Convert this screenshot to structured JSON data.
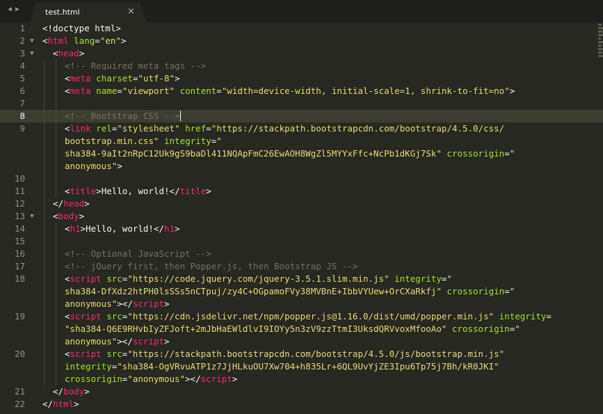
{
  "tab": {
    "title": "test.html",
    "close_glyph": "×"
  },
  "nav": {
    "back_icon": "◀",
    "forward_icon": "▶"
  },
  "fold_glyph": "▼",
  "colors": {
    "background": "#272822",
    "tag": "#f92672",
    "attribute": "#a6e22e",
    "string": "#e6db74",
    "comment": "#75715e",
    "text": "#f8f8f2"
  },
  "editor": {
    "current_line": "8",
    "line_numbers": [
      "1",
      "2",
      "3",
      "4",
      "5",
      "6",
      "7",
      "8",
      "9",
      "",
      "",
      "",
      "10",
      "11",
      "12",
      "13",
      "14",
      "15",
      "16",
      "17",
      "18",
      "",
      "",
      "19",
      "",
      "",
      "20",
      "",
      "",
      "21",
      "22"
    ],
    "code": {
      "l01": [
        "<!doctype html>"
      ],
      "l02": [
        "<",
        "html",
        " ",
        "lang",
        "=",
        "\"en\"",
        ">"
      ],
      "l03": [
        "  <",
        "head",
        ">"
      ],
      "l04": [
        "<!-- Required meta tags -->"
      ],
      "l05": [
        "<",
        "meta",
        " ",
        "charset",
        "=",
        "\"utf-8\"",
        ">"
      ],
      "l06": [
        "<",
        "meta",
        " ",
        "name",
        "=",
        "\"viewport\"",
        " ",
        "content",
        "=",
        "\"width=device-width, initial-scale=1, shrink-to-fit=no\"",
        ">"
      ],
      "l08": [
        "<!-- Bootstrap CSS -->"
      ],
      "l09a": [
        "<",
        "link",
        " ",
        "rel",
        "=",
        "\"stylesheet\"",
        " ",
        "href",
        "=",
        "\"https://stackpath.bootstrapcdn.com/bootstrap/4.5.0/css/"
      ],
      "l09b": [
        "bootstrap.min.css\"",
        " ",
        "integrity",
        "=",
        "\""
      ],
      "l09c": [
        "sha384-9aIt2nRpC12Uk9gS9baDl411NQApFmC26EwAOH8WgZl5MYYxFfc+NcPb1dKGj7Sk\"",
        " ",
        "crossorigin",
        "=",
        "\""
      ],
      "l09d": [
        "anonymous\"",
        ">"
      ],
      "l11": [
        "<",
        "title",
        ">",
        "Hello, world!",
        "</",
        "title",
        ">"
      ],
      "l12": [
        "</",
        "head",
        ">"
      ],
      "l13": [
        "<",
        "body",
        ">"
      ],
      "l14": [
        "<",
        "h1",
        ">",
        "Hello, world!",
        "</",
        "h1",
        ">"
      ],
      "l16": [
        "<!-- Optional JavaScript -->"
      ],
      "l17": [
        "<!-- jQuery first, then Popper.js, then Bootstrap JS -->"
      ],
      "l18a": [
        "<",
        "script",
        " ",
        "src",
        "=",
        "\"https://code.jquery.com/jquery-3.5.1.slim.min.js\"",
        " ",
        "integrity",
        "=",
        "\""
      ],
      "l18b": [
        "sha384-DfXdz2htPH0lsSSs5nCTpuj/zy4C+OGpamoFVy38MVBnE+IbbVYUew+OrCXaRkfj\"",
        " ",
        "crossorigin",
        "=",
        "\""
      ],
      "l18c": [
        "anonymous\"",
        "></",
        "script",
        ">"
      ],
      "l19a": [
        "<",
        "script",
        " ",
        "src",
        "=",
        "\"https://cdn.jsdelivr.net/npm/popper.js@1.16.0/dist/umd/popper.min.js\"",
        " ",
        "integrity",
        "="
      ],
      "l19b": [
        "\"sha384-Q6E9RHvbIyZFJoft+2mJbHaEWldlvI9IOYy5n3zV9zzTtmI3UksdQRVvoxMfooAo\"",
        " ",
        "crossorigin",
        "=",
        "\""
      ],
      "l19c": [
        "anonymous\"",
        "></",
        "script",
        ">"
      ],
      "l20a": [
        "<",
        "script",
        " ",
        "src",
        "=",
        "\"https://stackpath.bootstrapcdn.com/bootstrap/4.5.0/js/bootstrap.min.js\""
      ],
      "l20b": [
        "integrity",
        "=",
        "\"sha384-OgVRvuATP1z7JjHLkuOU7Xw704+h835Lr+6QL9UvYjZE3Ipu6Tp75j7Bh/kR0JKI\""
      ],
      "l20c": [
        "crossorigin",
        "=",
        "\"anonymous\"",
        "></",
        "script",
        ">"
      ],
      "l21": [
        "</",
        "body",
        ">"
      ],
      "l22": [
        "</",
        "html",
        ">"
      ]
    }
  }
}
